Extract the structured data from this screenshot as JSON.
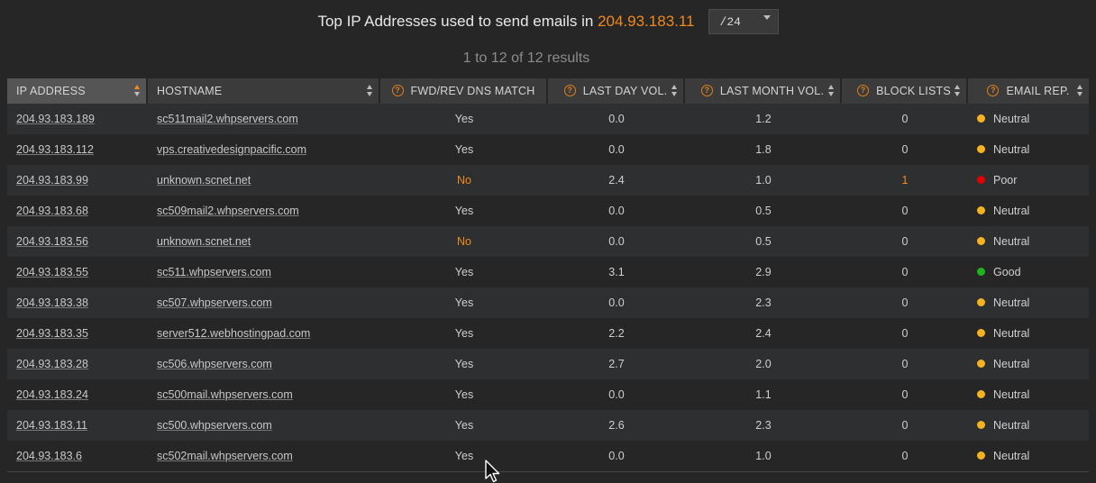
{
  "header": {
    "title_prefix": "Top IP Addresses used to send emails in",
    "title_ip": "204.93.183.11",
    "subnet_value": "/24"
  },
  "results_text": "1 to 12 of 12 results",
  "columns": {
    "ip": "IP ADDRESS",
    "hostname": "HOSTNAME",
    "dns": "FWD/REV DNS MATCH",
    "day": "LAST DAY VOL.",
    "month": "LAST MONTH VOL.",
    "block": "BLOCK LISTS",
    "rep": "EMAIL REP."
  },
  "colors": {
    "accent": "#f08a1c",
    "neutral": "#f5b321",
    "poor": "#e00000",
    "good": "#1fb31f"
  },
  "rows": [
    {
      "ip": "204.93.183.189",
      "host": "sc511mail2.whpservers.com",
      "dns": "Yes",
      "day": "0.0",
      "month": "1.2",
      "block": "0",
      "rep": "Neutral",
      "rep_color": "#f5b321",
      "dns_bad": false,
      "block_bad": false
    },
    {
      "ip": "204.93.183.112",
      "host": "vps.creativedesignpacific.com",
      "dns": "Yes",
      "day": "0.0",
      "month": "1.8",
      "block": "0",
      "rep": "Neutral",
      "rep_color": "#f5b321",
      "dns_bad": false,
      "block_bad": false
    },
    {
      "ip": "204.93.183.99",
      "host": "unknown.scnet.net",
      "dns": "No",
      "day": "2.4",
      "month": "1.0",
      "block": "1",
      "rep": "Poor",
      "rep_color": "#e00000",
      "dns_bad": true,
      "block_bad": true
    },
    {
      "ip": "204.93.183.68",
      "host": "sc509mail2.whpservers.com",
      "dns": "Yes",
      "day": "0.0",
      "month": "0.5",
      "block": "0",
      "rep": "Neutral",
      "rep_color": "#f5b321",
      "dns_bad": false,
      "block_bad": false
    },
    {
      "ip": "204.93.183.56",
      "host": "unknown.scnet.net",
      "dns": "No",
      "day": "0.0",
      "month": "0.5",
      "block": "0",
      "rep": "Neutral",
      "rep_color": "#f5b321",
      "dns_bad": true,
      "block_bad": false
    },
    {
      "ip": "204.93.183.55",
      "host": "sc511.whpservers.com",
      "dns": "Yes",
      "day": "3.1",
      "month": "2.9",
      "block": "0",
      "rep": "Good",
      "rep_color": "#1fb31f",
      "dns_bad": false,
      "block_bad": false
    },
    {
      "ip": "204.93.183.38",
      "host": "sc507.whpservers.com",
      "dns": "Yes",
      "day": "0.0",
      "month": "2.3",
      "block": "0",
      "rep": "Neutral",
      "rep_color": "#f5b321",
      "dns_bad": false,
      "block_bad": false
    },
    {
      "ip": "204.93.183.35",
      "host": "server512.webhostingpad.com",
      "dns": "Yes",
      "day": "2.2",
      "month": "2.4",
      "block": "0",
      "rep": "Neutral",
      "rep_color": "#f5b321",
      "dns_bad": false,
      "block_bad": false
    },
    {
      "ip": "204.93.183.28",
      "host": "sc506.whpservers.com",
      "dns": "Yes",
      "day": "2.7",
      "month": "2.0",
      "block": "0",
      "rep": "Neutral",
      "rep_color": "#f5b321",
      "dns_bad": false,
      "block_bad": false
    },
    {
      "ip": "204.93.183.24",
      "host": "sc500mail.whpservers.com",
      "dns": "Yes",
      "day": "0.0",
      "month": "1.1",
      "block": "0",
      "rep": "Neutral",
      "rep_color": "#f5b321",
      "dns_bad": false,
      "block_bad": false
    },
    {
      "ip": "204.93.183.11",
      "host": "sc500.whpservers.com",
      "dns": "Yes",
      "day": "2.6",
      "month": "2.3",
      "block": "0",
      "rep": "Neutral",
      "rep_color": "#f5b321",
      "dns_bad": false,
      "block_bad": false
    },
    {
      "ip": "204.93.183.6",
      "host": "sc502mail.whpservers.com",
      "dns": "Yes",
      "day": "0.0",
      "month": "1.0",
      "block": "0",
      "rep": "Neutral",
      "rep_color": "#f5b321",
      "dns_bad": false,
      "block_bad": false
    }
  ]
}
